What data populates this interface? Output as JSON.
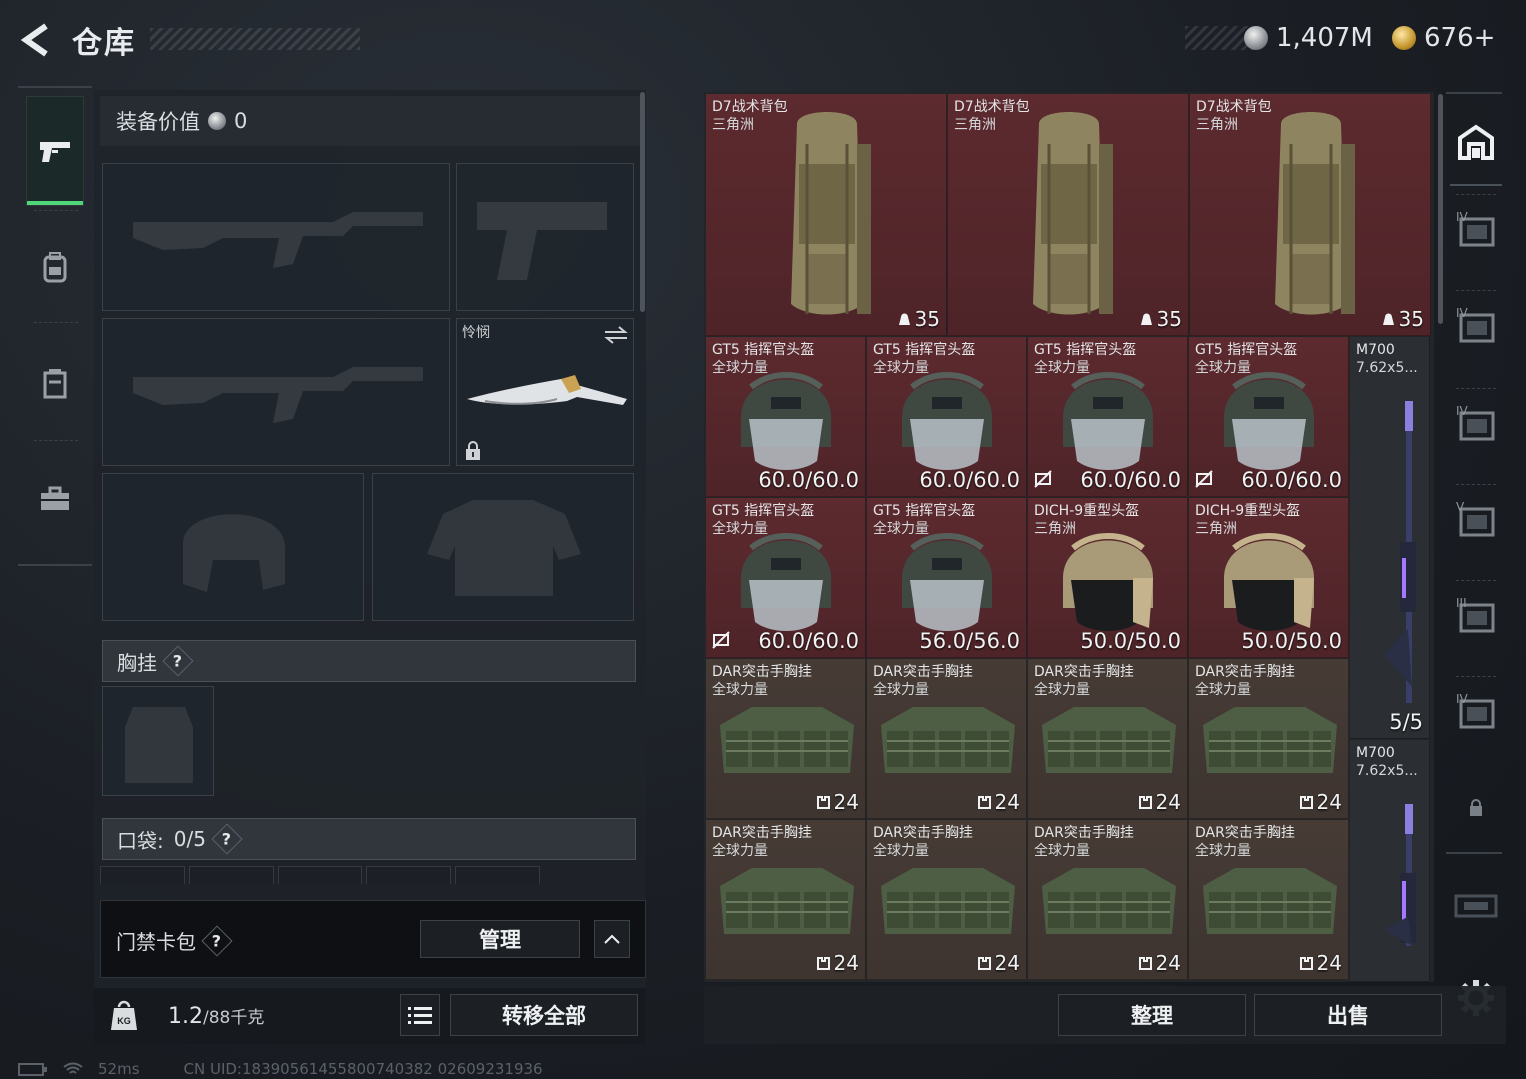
{
  "header": {
    "title": "仓库",
    "currency_silver": "1,407M",
    "currency_gold": "676+"
  },
  "left_nav": {
    "items": [
      "firearm-tab",
      "backpack-tab",
      "storage-tab",
      "toolbox-tab"
    ]
  },
  "equipment": {
    "value_label": "装备价值",
    "value": "0",
    "melee_name": "怜悯",
    "chest_rig_label": "胸挂",
    "pocket_label": "口袋:",
    "pocket_value": "0/5",
    "help_mark": "?"
  },
  "keycard": {
    "label": "门禁卡包",
    "manage_button": "管理"
  },
  "footer_left": {
    "weight": "1.2",
    "weight_cap": "/88千克",
    "transfer_all": "转移全部"
  },
  "status": {
    "ping": "52ms",
    "uid": "CN UID:18390561455800740382 02609231936"
  },
  "inventory": {
    "backpacks": [
      {
        "name": "D7战术背包",
        "sub": "三角洲",
        "count": "35"
      },
      {
        "name": "D7战术背包",
        "sub": "三角洲",
        "count": "35"
      },
      {
        "name": "D7战术背包",
        "sub": "三角洲",
        "count": "35"
      }
    ],
    "helmets_row1": [
      {
        "name": "GT5 指挥官头盔",
        "sub": "全球力量",
        "dur": "60.0/60.0",
        "noins": false
      },
      {
        "name": "GT5 指挥官头盔",
        "sub": "全球力量",
        "dur": "60.0/60.0",
        "noins": false
      },
      {
        "name": "GT5 指挥官头盔",
        "sub": "全球力量",
        "dur": "60.0/60.0",
        "noins": true
      },
      {
        "name": "GT5 指挥官头盔",
        "sub": "全球力量",
        "dur": "60.0/60.0",
        "noins": true
      }
    ],
    "helmets_row2": [
      {
        "name": "GT5 指挥官头盔",
        "sub": "全球力量",
        "dur": "60.0/60.0",
        "noins": true
      },
      {
        "name": "GT5 指挥官头盔",
        "sub": "全球力量",
        "dur": "56.0/56.0",
        "noins": false
      },
      {
        "name": "DICH-9重型头盔",
        "sub": "三角洲",
        "dur": "50.0/50.0",
        "noins": false
      },
      {
        "name": "DICH-9重型头盔",
        "sub": "三角洲",
        "dur": "50.0/50.0",
        "noins": false
      }
    ],
    "rigs_row1": [
      {
        "name": "DAR突击手胸挂",
        "sub": "全球力量",
        "count": "24"
      },
      {
        "name": "DAR突击手胸挂",
        "sub": "全球力量",
        "count": "24"
      },
      {
        "name": "DAR突击手胸挂",
        "sub": "全球力量",
        "count": "24"
      },
      {
        "name": "DAR突击手胸挂",
        "sub": "全球力量",
        "count": "24"
      }
    ],
    "rigs_row2": [
      {
        "name": "DAR突击手胸挂",
        "sub": "全球力量",
        "count": "24"
      },
      {
        "name": "DAR突击手胸挂",
        "sub": "全球力量",
        "count": "24"
      },
      {
        "name": "DAR突击手胸挂",
        "sub": "全球力量",
        "count": "24"
      },
      {
        "name": "DAR突击手胸挂",
        "sub": "全球力量",
        "count": "24"
      }
    ],
    "rifles": [
      {
        "name": "M700",
        "sub": "7.62x5...",
        "ammo": "5/5"
      },
      {
        "name": "M700",
        "sub": "7.62x5...",
        "ammo": ""
      }
    ]
  },
  "right_rail": {
    "tabs": [
      "IV",
      "IV",
      "IV",
      "V",
      "III",
      "IV"
    ]
  },
  "actions": {
    "sort": "整理",
    "sell": "出售"
  },
  "colors": {
    "accent_green": "#4fd67a",
    "red_tile": "#5c2a2f",
    "brown_tile": "#463b35"
  }
}
